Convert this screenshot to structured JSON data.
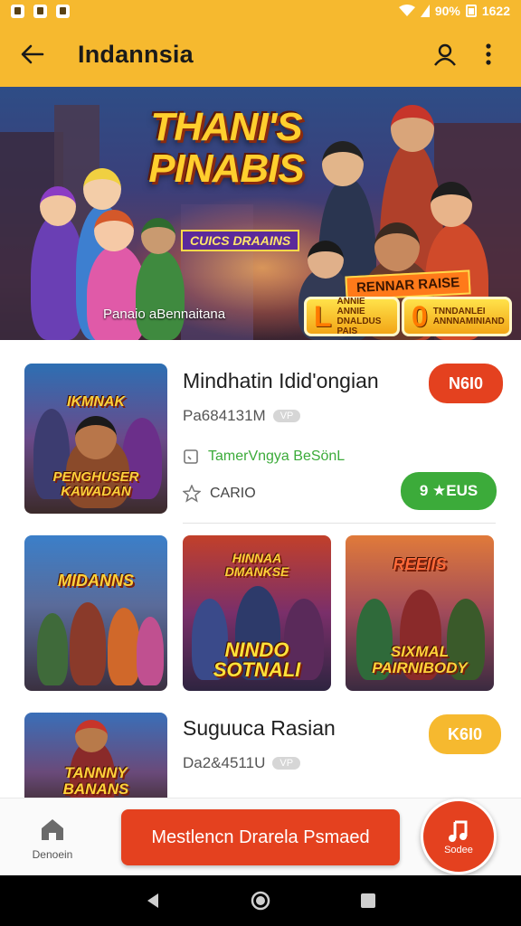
{
  "status_bar": {
    "battery": "90%",
    "time": "1622"
  },
  "app_bar": {
    "title": "Indannsia",
    "back_icon": "arrow-left-icon",
    "profile_icon": "person-icon",
    "menu_icon": "kebab-menu-icon"
  },
  "hero": {
    "title_line1": "THANI'S",
    "title_line2": "PINABIS",
    "ribbon": "CUICS DRAAINS",
    "caption": "Panaio aBennaitana",
    "banner": "RENNAR RAISE",
    "badge1": {
      "big": "L",
      "small": "ANNIE ANNIE DNALDUS PAIS"
    },
    "badge2": {
      "big": "0",
      "small": "TNNDANLEI ANNNAMINIAND"
    }
  },
  "featured": {
    "thumb_text_top": "IKMNAK",
    "thumb_text_bottom": "PENGHUSER KAWADAN",
    "title": "Mindhatin Idid'ongian",
    "meta": "Pa684131M",
    "meta_chip": "VP",
    "genre": "TamerVngya BeSönL",
    "rating_label": "CARIO",
    "badge_top": "N6I0",
    "badge_bottom": "9 ★EUS",
    "colors": {
      "red": "#e4411f",
      "green": "#3cab3a"
    }
  },
  "grid": [
    {
      "top_text": "MIDANNS",
      "bottom_text": ""
    },
    {
      "top_text": "HINNAA DMANKSE",
      "bottom_text": "NINDO SOTNALI"
    },
    {
      "top_text": "REEIIS",
      "bottom_text": "SIXMAL PAIRNIBODY"
    }
  ],
  "second": {
    "thumb_text": "TANNNY BANANS",
    "title": "Suguuca Rasian",
    "meta": "Da2&4511U",
    "meta_chip": "VP",
    "badge": "K6I0"
  },
  "bottom_bar": {
    "home_label": "Denoein",
    "cta_label": "Mestlencn Drarela Psmaed",
    "fab_label": "Sodee"
  }
}
